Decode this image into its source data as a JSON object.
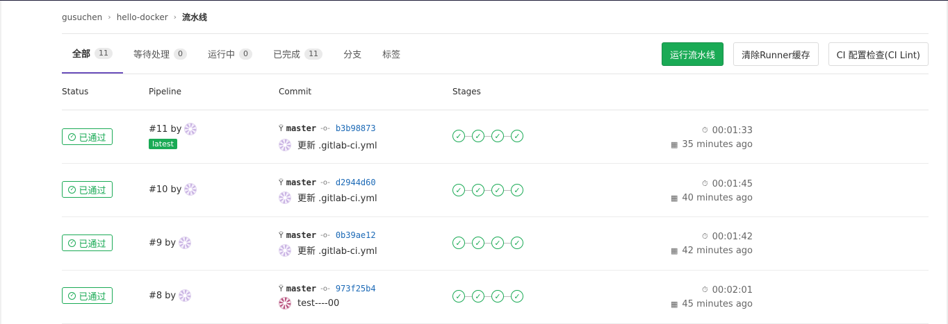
{
  "breadcrumb": {
    "items": [
      "gusuchen",
      "hello-docker"
    ],
    "current": "流水线"
  },
  "tabs": [
    {
      "label": "全部",
      "count": "11",
      "active": true
    },
    {
      "label": "等待处理",
      "count": "0"
    },
    {
      "label": "运行中",
      "count": "0"
    },
    {
      "label": "已完成",
      "count": "11"
    },
    {
      "label": "分支",
      "count": null
    },
    {
      "label": "标签",
      "count": null
    }
  ],
  "actions": {
    "run_pipeline": "运行流水线",
    "clear_cache": "清除Runner缓存",
    "ci_lint": "CI 配置检查(CI Lint)"
  },
  "table": {
    "headers": {
      "status": "Status",
      "pipeline": "Pipeline",
      "commit": "Commit",
      "stages": "Stages"
    },
    "rows": [
      {
        "status": "已通过",
        "pipeline_id": "#11",
        "by": "by",
        "latest": "latest",
        "branch": "master",
        "sha": "b3b98873",
        "message": "更新 .gitlab-ci.yml",
        "stages": 4,
        "duration": "00:01:33",
        "finished": "35 minutes ago"
      },
      {
        "status": "已通过",
        "pipeline_id": "#10",
        "by": "by",
        "latest": null,
        "branch": "master",
        "sha": "d2944d60",
        "message": "更新 .gitlab-ci.yml",
        "stages": 4,
        "duration": "00:01:45",
        "finished": "40 minutes ago"
      },
      {
        "status": "已通过",
        "pipeline_id": "#9",
        "by": "by",
        "latest": null,
        "branch": "master",
        "sha": "0b39ae12",
        "message": "更新 .gitlab-ci.yml",
        "stages": 4,
        "duration": "00:01:42",
        "finished": "42 minutes ago"
      },
      {
        "status": "已通过",
        "pipeline_id": "#8",
        "by": "by",
        "latest": null,
        "branch": "master",
        "sha": "973f25b4",
        "message": "test----00",
        "stages": 4,
        "duration": "00:02:01",
        "finished": "45 minutes ago"
      }
    ]
  },
  "colors": {
    "success": "#1aaa55",
    "active_tab_underline": "#6b4fbb",
    "sha_link": "#1b69b6"
  },
  "icons": {
    "status": "check-circle-icon",
    "branch": "branch-icon",
    "commit": "commit-icon",
    "duration": "timer-icon",
    "finished": "calendar-icon",
    "stage": "stage-success-icon"
  }
}
